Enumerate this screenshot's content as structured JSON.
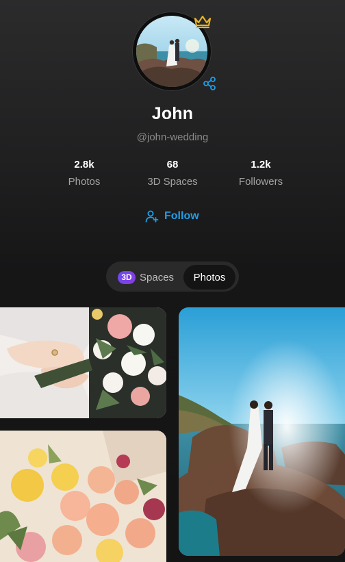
{
  "profile": {
    "name": "John",
    "handle": "@john-wedding",
    "badge_icon": "crown-icon",
    "share_icon": "share-icon",
    "accent_color": "#1f9fe8",
    "crown_color": "#e6b422"
  },
  "stats": [
    {
      "value": "2.8k",
      "label": "Photos"
    },
    {
      "value": "68",
      "label": "3D Spaces"
    },
    {
      "value": "1.2k",
      "label": "Followers"
    }
  ],
  "follow": {
    "label": "Follow",
    "icon": "add-user-icon"
  },
  "tabs": {
    "spaces_badge": "3D",
    "spaces_label": "Spaces",
    "photos_label": "Photos",
    "active": "Photos"
  },
  "gallery": [
    {
      "subject": "bride-hands-bouquet"
    },
    {
      "subject": "couple-on-seaside-rocks"
    },
    {
      "subject": "peach-rose-flowers"
    }
  ]
}
